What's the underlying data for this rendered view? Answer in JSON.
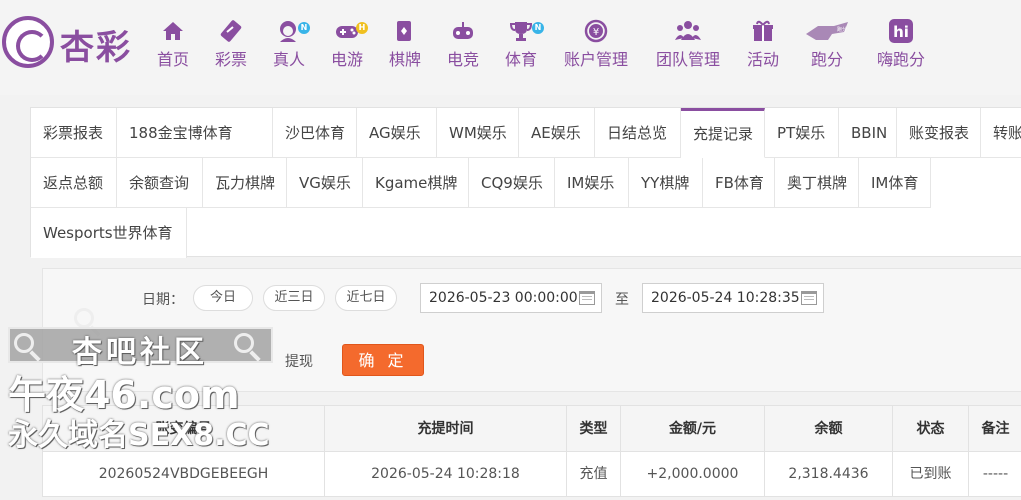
{
  "brand": {
    "name": "杏彩"
  },
  "nav": [
    {
      "label": "首页",
      "icon": "home-icon",
      "badge": ""
    },
    {
      "label": "彩票",
      "icon": "ticket-icon",
      "badge": ""
    },
    {
      "label": "真人",
      "icon": "dealer-icon",
      "badge": "N"
    },
    {
      "label": "电游",
      "icon": "gamepad-icon",
      "badge": "H"
    },
    {
      "label": "棋牌",
      "icon": "cards-icon",
      "badge": ""
    },
    {
      "label": "电竞",
      "icon": "esports-icon",
      "badge": ""
    },
    {
      "label": "体育",
      "icon": "trophy-icon",
      "badge": "N"
    },
    {
      "label": "账户管理",
      "icon": "yuan-coin-icon",
      "badge": ""
    },
    {
      "label": "团队管理",
      "icon": "team-icon",
      "badge": ""
    },
    {
      "label": "活动",
      "icon": "gift-icon",
      "badge": ""
    },
    {
      "label": "跑分",
      "icon": "runner-icon",
      "badge": ""
    },
    {
      "label": "嗨跑分",
      "icon": "hi-icon",
      "badge": ""
    }
  ],
  "tabs": {
    "row1": [
      "彩票报表",
      "188金宝博体育",
      "沙巴体育",
      "AG娱乐",
      "WM娱乐",
      "AE娱乐",
      "日结总览",
      "充提记录",
      "PT娱乐",
      "BBIN",
      "账变报表",
      "转账报表"
    ],
    "row2": [
      "返点总额",
      "余额查询",
      "瓦力棋牌",
      "VG娱乐",
      "Kgame棋牌",
      "CQ9娱乐",
      "IM娱乐",
      "YY棋牌",
      "FB体育",
      "奥丁棋牌",
      "IM体育"
    ],
    "row3": [
      "Wesports世界体育"
    ],
    "active": "充提记录"
  },
  "filter": {
    "date_label": "日期：",
    "quick": [
      "今日",
      "近三日",
      "近七日"
    ],
    "start": "2026-05-23 00:00:00",
    "to_label": "至",
    "end": "2026-05-24 10:28:35",
    "type_option": "提现",
    "confirm": "确 定"
  },
  "watermark": {
    "line1": "杏吧社区",
    "line2": "午夜46.com",
    "line3": "永久域名SEX8.CC"
  },
  "table": {
    "headers": [
      "账变编号",
      "充提时间",
      "类型",
      "金额/元",
      "余额",
      "状态",
      "备注"
    ],
    "rows": [
      {
        "id": "20260524VBDGEBEEGH",
        "time": "2026-05-24 10:28:18",
        "type": "充值",
        "amount": "+2,000.0000",
        "balance": "2,318.4436",
        "status": "已到账",
        "note": "-----"
      }
    ]
  },
  "colors": {
    "brand": "#8a4ea0",
    "confirm": "#f46a2d",
    "amount": "#e0303a",
    "status": "#2a9a2a"
  }
}
